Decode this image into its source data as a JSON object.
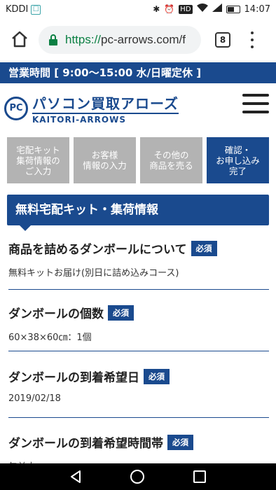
{
  "status_bar": {
    "carrier": "KDDI",
    "hd_label": "HD",
    "time": "14:07"
  },
  "browser": {
    "url_scheme": "https://",
    "url_host": "pc-arrows.com/f",
    "tab_count": "8"
  },
  "hours_banner": "営業時間 [ 9:00〜15:00 水/日曜定休 ]",
  "logo": {
    "badge": "PC",
    "title_jp": "パソコン買取アローズ",
    "title_en": "KAITORI-ARROWS"
  },
  "steps": [
    {
      "label": "宅配キット\n集荷情報の\nご入力"
    },
    {
      "label": "お客様\n情報の入力"
    },
    {
      "label": "その他の\n商品を売る"
    },
    {
      "label": "確認・\nお申し込み\n完了"
    }
  ],
  "section_title": "無料宅配キット・集荷情報",
  "fields": [
    {
      "label": "商品を詰めるダンボールについて",
      "badge": "必須",
      "value": "無料キットお届け(別日に詰め込みコース)"
    },
    {
      "label": "ダンボールの個数",
      "badge": "必須",
      "value": "60×38×60㎝：1個"
    },
    {
      "label": "ダンボールの到着希望日",
      "badge": "必須",
      "value": "2019/02/18"
    },
    {
      "label": "ダンボールの到着希望時間帯",
      "badge": "必須",
      "value": "午前中"
    }
  ]
}
